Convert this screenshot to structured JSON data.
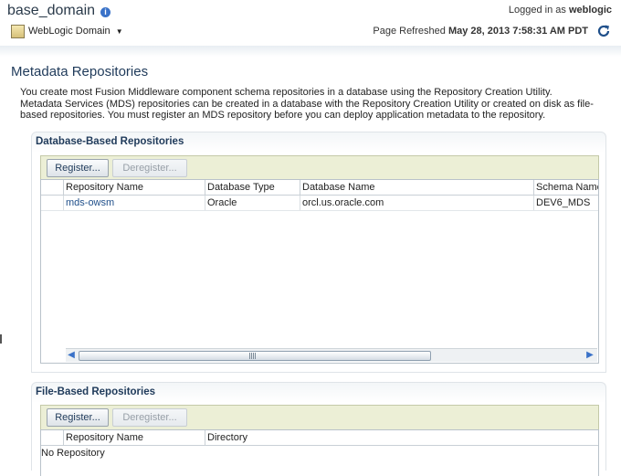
{
  "header": {
    "domain_title": "base_domain",
    "info_icon": "i",
    "logged_in_label": "Logged in as",
    "username": "weblogic",
    "domain_menu_label": "WebLogic Domain",
    "refresh_label": "Page Refreshed",
    "refresh_time": "May 28, 2013 7:58:31 AM PDT"
  },
  "page": {
    "title": "Metadata Repositories",
    "description": "You create most Fusion Middleware component schema repositories in a database using the Repository Creation Utility. Metadata Services (MDS) repositories can be created in a database with the Repository Creation Utility or created on disk as file-based repositories. You must register an MDS repository before you can deploy application metadata to the repository."
  },
  "database_section": {
    "title": "Database-Based Repositories",
    "register_label": "Register...",
    "deregister_label": "Deregister...",
    "columns": [
      "Repository Name",
      "Database Type",
      "Database Name",
      "Schema Name"
    ],
    "rows": [
      {
        "repository_name": "mds-owsm",
        "database_type": "Oracle",
        "database_name": "orcl.us.oracle.com",
        "schema_name": "DEV6_MDS"
      }
    ]
  },
  "file_section": {
    "title": "File-Based Repositories",
    "register_label": "Register...",
    "deregister_label": "Deregister...",
    "columns": [
      "Repository Name",
      "Directory"
    ],
    "empty_text": "No Repository"
  },
  "colors": {
    "title": "#1f3a5a",
    "link": "#1f4f8a",
    "toolbar_bg": "#ecefd6",
    "accent_icon": "#3a72c8"
  }
}
